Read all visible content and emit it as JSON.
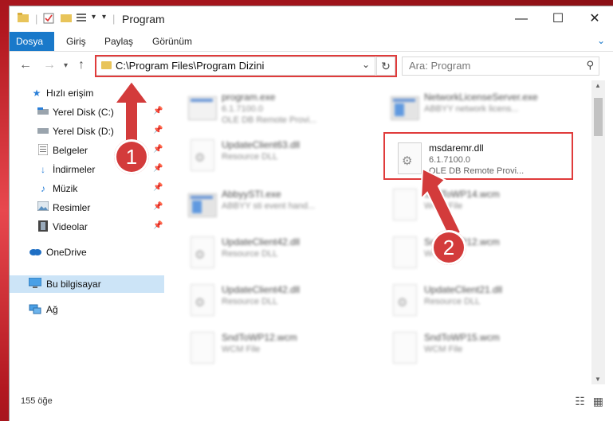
{
  "window": {
    "title": "Program",
    "qa_dropdown": "▾",
    "controls": {
      "minimize": "—",
      "maximize": "☐",
      "close": "✕"
    }
  },
  "ribbon": {
    "tabs": [
      "Dosya",
      "Giriş",
      "Paylaş",
      "Görünüm"
    ],
    "expand": "⌄"
  },
  "nav": {
    "address": "C:\\Program Files\\Program Dizini",
    "search_placeholder": "Ara: Program"
  },
  "sidebar": {
    "items": [
      {
        "label": "Hızlı erişim",
        "icon": "star-icon",
        "pinned": false
      },
      {
        "label": "Yerel Disk (C:)",
        "icon": "drive-icon",
        "pinned": true
      },
      {
        "label": "Yerel Disk (D:)",
        "icon": "drive-icon",
        "pinned": true
      },
      {
        "label": "Belgeler",
        "icon": "documents-icon",
        "pinned": true
      },
      {
        "label": "İndirmeler",
        "icon": "download-icon",
        "pinned": true
      },
      {
        "label": "Müzik",
        "icon": "music-icon",
        "pinned": true
      },
      {
        "label": "Resimler",
        "icon": "pictures-icon",
        "pinned": true
      },
      {
        "label": "Videolar",
        "icon": "video-icon",
        "pinned": true
      },
      {
        "label": "OneDrive",
        "icon": "cloud-icon",
        "pinned": false
      },
      {
        "label": "Bu bilgisayar",
        "icon": "computer-icon",
        "pinned": false,
        "selected": true
      },
      {
        "label": "Ağ",
        "icon": "network-icon",
        "pinned": false
      }
    ]
  },
  "files": [
    {
      "name": "program.exe",
      "l2": "6.1.7100.0",
      "l3": "OLE DB Remote Provi...",
      "type": "exe",
      "blurred": true
    },
    {
      "name": "NetworkLicenseServer.exe",
      "l2": "ABBYY network licens...",
      "l3": "",
      "type": "exe",
      "blurred": true
    },
    {
      "name": "UpdateClient63.dll",
      "l2": "Resource DLL",
      "l3": "",
      "type": "dll",
      "blurred": true
    },
    {
      "name": "msdaremr.dll",
      "l2": "6.1.7100.0",
      "l3": "OLE DB Remote Provi...",
      "type": "dll",
      "blurred": false
    },
    {
      "name": "AbbyySTI.exe",
      "l2": "ABBYY sti event hand...",
      "l3": "",
      "type": "exe",
      "blurred": true
    },
    {
      "name": "SndToWP14.wcm",
      "l2": "WCM File",
      "l3": "",
      "type": "doc",
      "blurred": true
    },
    {
      "name": "UpdateClient42.dll",
      "l2": "Resource DLL",
      "l3": "",
      "type": "dll",
      "blurred": true
    },
    {
      "name": "SndToWP12.wcm",
      "l2": "WCM File",
      "l3": "",
      "type": "doc",
      "blurred": true
    },
    {
      "name": "UpdateClient42.dll",
      "l2": "Resource DLL",
      "l3": "",
      "type": "dll",
      "blurred": true
    },
    {
      "name": "UpdateClient21.dll",
      "l2": "Resource DLL",
      "l3": "",
      "type": "dll",
      "blurred": true
    },
    {
      "name": "SndToWP12.wcm",
      "l2": "WCM File",
      "l3": "",
      "type": "doc",
      "blurred": true
    },
    {
      "name": "SndToWP15.wcm",
      "l2": "WCM File",
      "l3": "",
      "type": "doc",
      "blurred": true
    }
  ],
  "status": {
    "count": "155 öğe"
  },
  "badges": [
    "1",
    "2"
  ],
  "colors": {
    "accent": "#1979ca",
    "highlight": "#e03b3b",
    "badge": "#d33b3b"
  }
}
